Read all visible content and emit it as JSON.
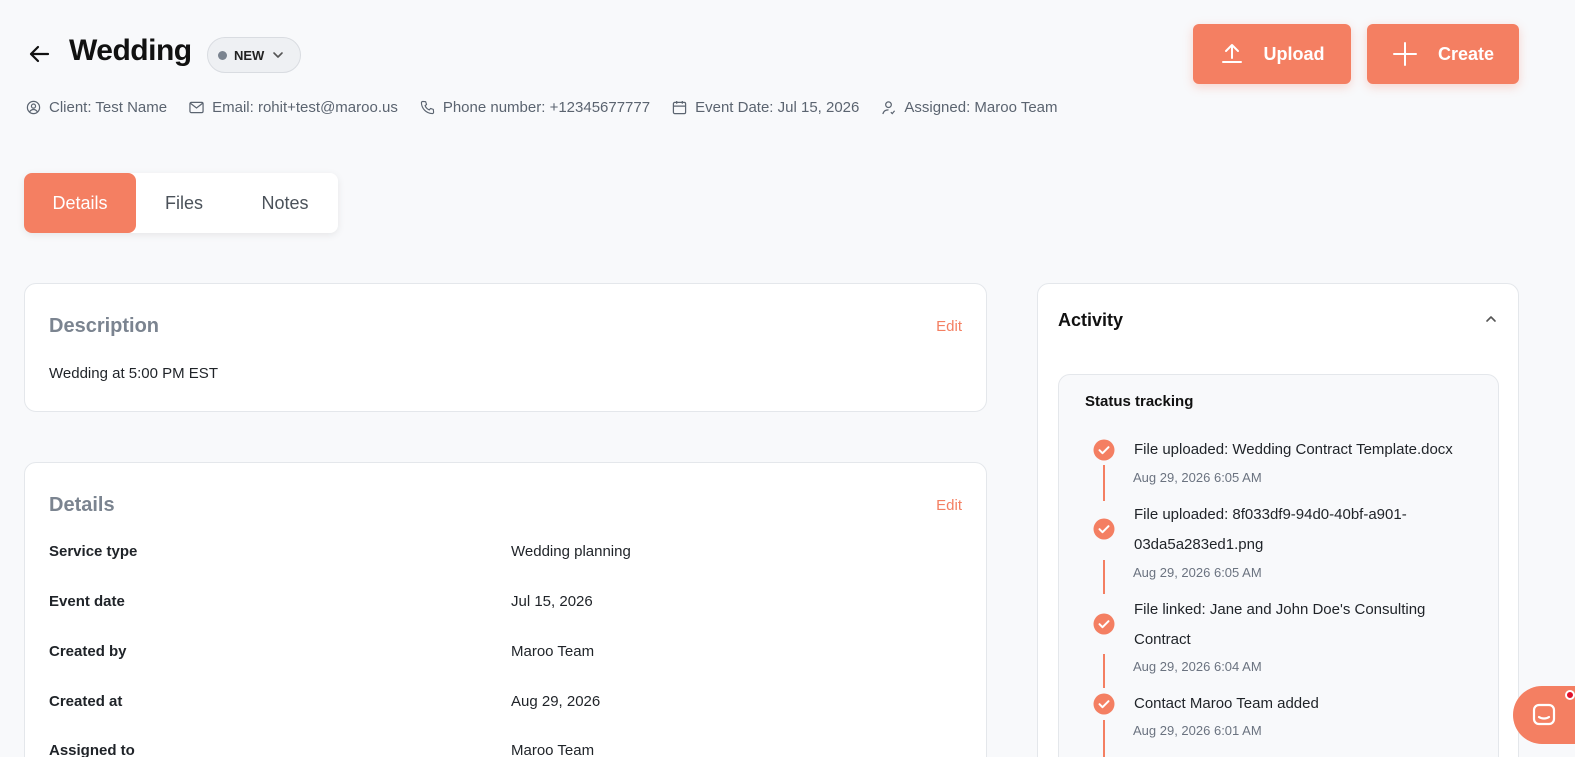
{
  "header": {
    "title": "Wedding",
    "status": "NEW",
    "upload_label": "Upload",
    "create_label": "Create"
  },
  "meta": {
    "client": "Client: Test Name",
    "email": "Email: rohit+test@maroo.us",
    "phone": "Phone number: +12345677777",
    "event_date": "Event Date: Jul 15, 2026",
    "assigned": "Assigned: Maroo Team"
  },
  "tabs": [
    {
      "label": "Details"
    },
    {
      "label": "Files"
    },
    {
      "label": "Notes"
    }
  ],
  "description": {
    "heading": "Description",
    "edit_label": "Edit",
    "text": "Wedding at 5:00 PM EST"
  },
  "details": {
    "heading": "Details",
    "edit_label": "Edit",
    "rows": [
      {
        "label": "Service type",
        "value": "Wedding planning"
      },
      {
        "label": "Event date",
        "value": "Jul 15, 2026"
      },
      {
        "label": "Created by",
        "value": "Maroo Team"
      },
      {
        "label": "Created at",
        "value": "Aug 29, 2026"
      },
      {
        "label": "Assigned to",
        "value": "Maroo Team"
      }
    ]
  },
  "activity": {
    "heading": "Activity",
    "status_heading": "Status tracking",
    "items": [
      {
        "text": "File uploaded: Wedding Contract Template.docx",
        "time": "Aug 29, 2026 6:05 AM"
      },
      {
        "text": "File uploaded: 8f033df9-94d0-40bf-a901-03da5a283ed1.png",
        "time": "Aug 29, 2026 6:05 AM"
      },
      {
        "text": "File linked: Jane and John Doe's Consulting Contract",
        "time": "Aug 29, 2026 6:04 AM"
      },
      {
        "text": "Contact Maroo Team added",
        "time": "Aug 29, 2026 6:01 AM"
      }
    ]
  },
  "colors": {
    "accent": "#f47f62",
    "muted_heading": "#7b8490",
    "background": "#f8f9fb"
  }
}
